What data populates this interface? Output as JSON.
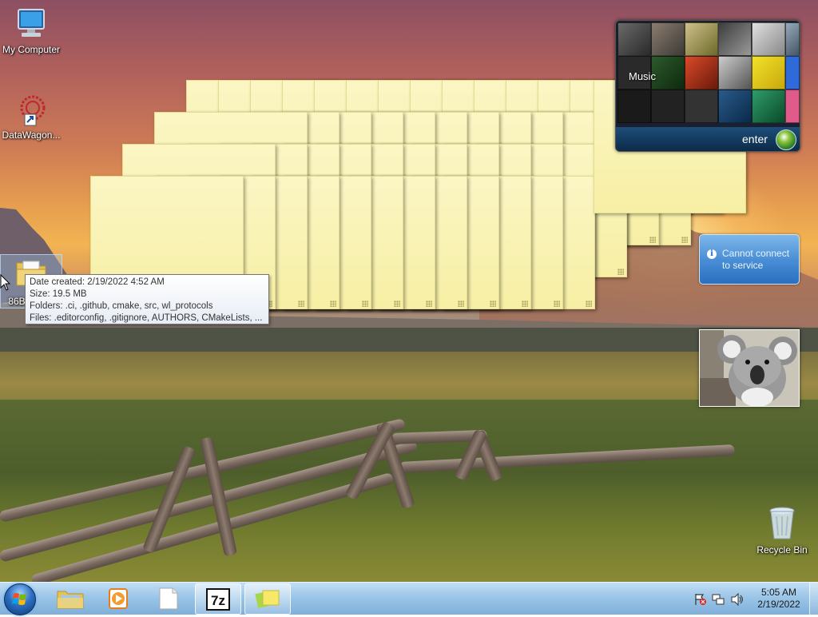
{
  "desktop": {
    "icons": [
      {
        "label": "My Computer",
        "icon": "computer-icon"
      },
      {
        "label": "DataWagon...",
        "icon": "datawagon-shortcut-icon"
      },
      {
        "label": "86B",
        "icon": "folder-icon"
      },
      {
        "label": "Recycle Bin",
        "icon": "recycle-bin-icon"
      }
    ]
  },
  "tooltip": {
    "date_created": "Date created: 2/19/2022 4:52 AM",
    "size": "Size: 19.5 MB",
    "folders": "Folders: .ci, .github, cmake, src, wl_protocols",
    "files": "Files: .editorconfig, .gitignore, AUTHORS, CMakeLists, ..."
  },
  "gadgets": {
    "media_center": {
      "tile_label": "Music",
      "bar_label": "enter"
    },
    "weather": {
      "message": "Cannot connect to service",
      "info_glyph": "i"
    },
    "slideshow": {
      "subject": "koala-photo"
    }
  },
  "taskbar": {
    "pinned": [
      {
        "name": "windows-explorer-icon",
        "active": false
      },
      {
        "name": "media-player-icon",
        "active": false
      },
      {
        "name": "document-icon",
        "active": false
      },
      {
        "name": "7zip-icon",
        "active": true,
        "glyph": "7z"
      },
      {
        "name": "sticky-notes-icon",
        "active": true
      }
    ],
    "clock": {
      "time": "5:05 AM",
      "date": "2/19/2022"
    }
  },
  "colors": {
    "note_yellow": "#f7efa4",
    "taskbar_blue": "#96c3e6",
    "weather_blue": "#4a8fd6"
  }
}
